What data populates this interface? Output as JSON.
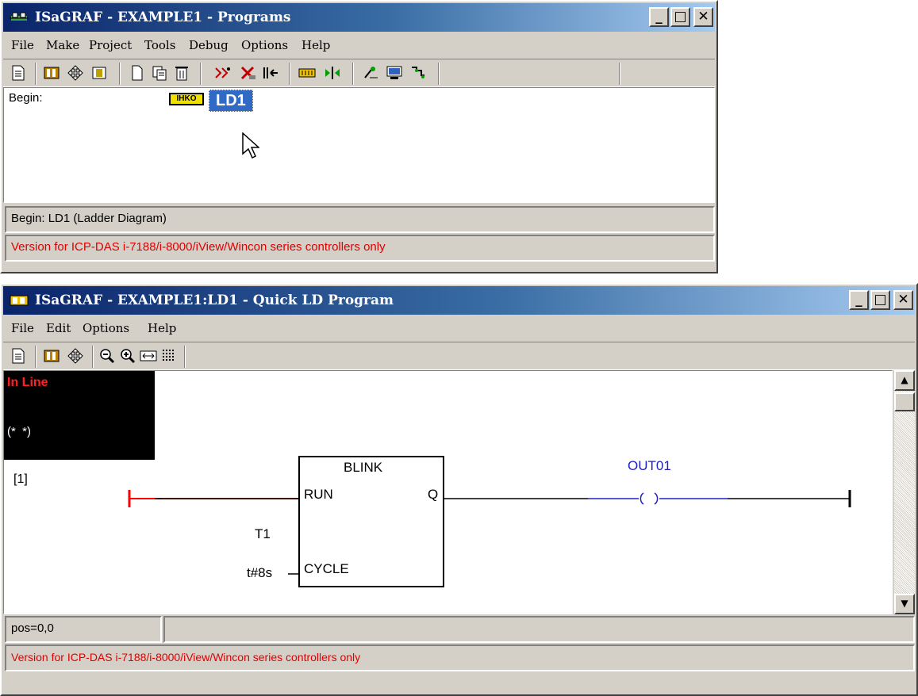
{
  "programs_window": {
    "title": "ISaGRAF - EXAMPLE1 - Programs",
    "menu": [
      "File",
      "Make",
      "Project",
      "Tools",
      "Debug",
      "Options",
      "Help"
    ],
    "section_label": "Begin:",
    "program_item": "LD1",
    "program_icon_text": "IHKO",
    "status_line1": "Begin:  LD1   (Ladder Diagram)",
    "status_line2": "Version for ICP-DAS i-7188/i-8000/iView/Wincon series controllers only"
  },
  "ld_window": {
    "title": "ISaGRAF - EXAMPLE1:LD1 - Quick LD Program",
    "menu": [
      "File",
      "Edit",
      "Options",
      "Help"
    ],
    "mode_badge": "In Line",
    "comment": "(*  *)",
    "rung_number": "[1]",
    "block_name": "BLINK",
    "block_input_run": "RUN",
    "block_input_cycle": "CYCLE",
    "block_output_q": "Q",
    "instance_name": "T1",
    "cycle_value": "t#8s",
    "coil_variable": "OUT01",
    "status_pos": "pos=0,0",
    "status_version": "Version for ICP-DAS i-7188/i-8000/iView/Wincon series controllers only"
  },
  "colors": {
    "title_gradient_start": "#0a246a",
    "selection": "#316ac5",
    "coil_blue": "#2020c0",
    "status_red": "#e00000"
  }
}
